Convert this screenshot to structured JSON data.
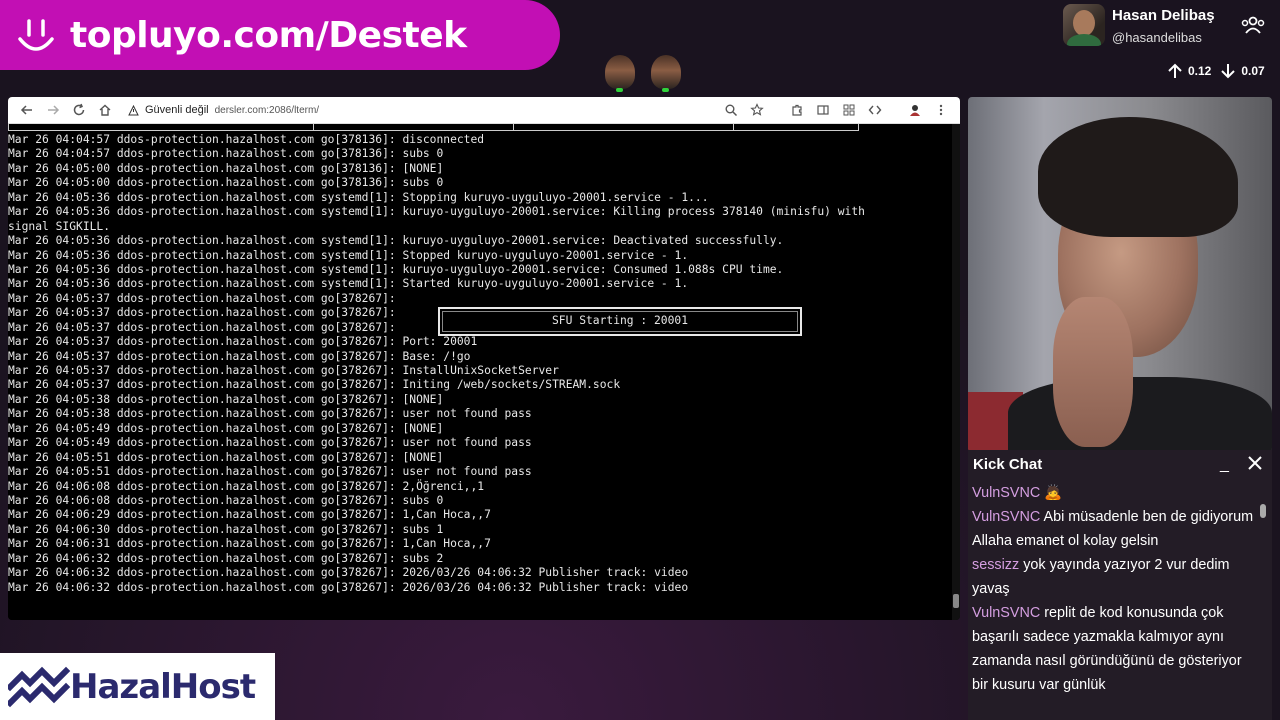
{
  "banner": {
    "text": "topluyo.com/Destek"
  },
  "profile": {
    "name": "Hasan Delibaş",
    "handle": "@hasandelibas"
  },
  "net": {
    "up": "0.12",
    "down": "0.07"
  },
  "browser": {
    "security": "Güvenli değil",
    "url": "dersler.com:2086/lterm/"
  },
  "terminal": {
    "lines": [
      "Mar 26 04:04:57 ddos-protection.hazalhost.com go[378136]: disconnected",
      "Mar 26 04:04:57 ddos-protection.hazalhost.com go[378136]: subs 0",
      "Mar 26 04:05:00 ddos-protection.hazalhost.com go[378136]: [NONE]",
      "Mar 26 04:05:00 ddos-protection.hazalhost.com go[378136]: subs 0",
      "Mar 26 04:05:36 ddos-protection.hazalhost.com systemd[1]: Stopping kuruyo-uyguluyo-20001.service - 1...",
      "Mar 26 04:05:36 ddos-protection.hazalhost.com systemd[1]: kuruyo-uyguluyo-20001.service: Killing process 378140 (minisfu) with",
      "signal SIGKILL.",
      "Mar 26 04:05:36 ddos-protection.hazalhost.com systemd[1]: kuruyo-uyguluyo-20001.service: Deactivated successfully.",
      "Mar 26 04:05:36 ddos-protection.hazalhost.com systemd[1]: Stopped kuruyo-uyguluyo-20001.service - 1.",
      "Mar 26 04:05:36 ddos-protection.hazalhost.com systemd[1]: kuruyo-uyguluyo-20001.service: Consumed 1.088s CPU time.",
      "Mar 26 04:05:36 ddos-protection.hazalhost.com systemd[1]: Started kuruyo-uyguluyo-20001.service - 1.",
      "Mar 26 04:05:37 ddos-protection.hazalhost.com go[378267]:",
      "Mar 26 04:05:37 ddos-protection.hazalhost.com go[378267]:",
      "Mar 26 04:05:37 ddos-protection.hazalhost.com go[378267]:",
      "Mar 26 04:05:37 ddos-protection.hazalhost.com go[378267]: Port: 20001",
      "Mar 26 04:05:37 ddos-protection.hazalhost.com go[378267]: Base: /!go",
      "Mar 26 04:05:37 ddos-protection.hazalhost.com go[378267]: InstallUnixSocketServer",
      "Mar 26 04:05:37 ddos-protection.hazalhost.com go[378267]: Initing /web/sockets/STREAM.sock",
      "Mar 26 04:05:38 ddos-protection.hazalhost.com go[378267]: [NONE]",
      "Mar 26 04:05:38 ddos-protection.hazalhost.com go[378267]: user not found pass",
      "Mar 26 04:05:49 ddos-protection.hazalhost.com go[378267]: [NONE]",
      "Mar 26 04:05:49 ddos-protection.hazalhost.com go[378267]: user not found pass",
      "Mar 26 04:05:51 ddos-protection.hazalhost.com go[378267]: [NONE]",
      "Mar 26 04:05:51 ddos-protection.hazalhost.com go[378267]: user not found pass",
      "Mar 26 04:06:08 ddos-protection.hazalhost.com go[378267]: 2,Öğrenci,,1",
      "Mar 26 04:06:08 ddos-protection.hazalhost.com go[378267]: subs 0",
      "Mar 26 04:06:29 ddos-protection.hazalhost.com go[378267]: 1,Can Hoca,,7",
      "Mar 26 04:06:30 ddos-protection.hazalhost.com go[378267]: subs 1",
      "Mar 26 04:06:31 ddos-protection.hazalhost.com go[378267]: 1,Can Hoca,,7",
      "Mar 26 04:06:32 ddos-protection.hazalhost.com go[378267]: subs 2",
      "Mar 26 04:06:32 ddos-protection.hazalhost.com go[378267]: 2026/03/26 04:06:32 Publisher track: video",
      "Mar 26 04:06:32 ddos-protection.hazalhost.com go[378267]: 2026/03/26 04:06:32 Publisher track: video"
    ],
    "sfu_box": "SFU Starting : 20001",
    "streamer_tag": "hasandelibas"
  },
  "chat": {
    "title": "Kick Chat",
    "messages": [
      {
        "user": "VulnSVNC",
        "text": "🙇"
      },
      {
        "user": "VulnSVNC",
        "text": "Abi müsadenle ben de gidiyorum Allaha emanet ol kolay gelsin"
      },
      {
        "user": "sessizz",
        "text": "yok yayında yazıyor 2 vur dedim yavaş"
      },
      {
        "user": "VulnSVNC",
        "text": "replit de kod konusunda çok başarılı sadece yazmakla kalmıyor aynı zamanda nasıl göründüğünü de gösteriyor bir kusuru var günlük"
      }
    ]
  },
  "logo": {
    "text": "HazalHost"
  },
  "colors": {
    "banner": "#c20fb4",
    "chat_user": "#d49ee0",
    "logo": "#2b2a6e"
  }
}
